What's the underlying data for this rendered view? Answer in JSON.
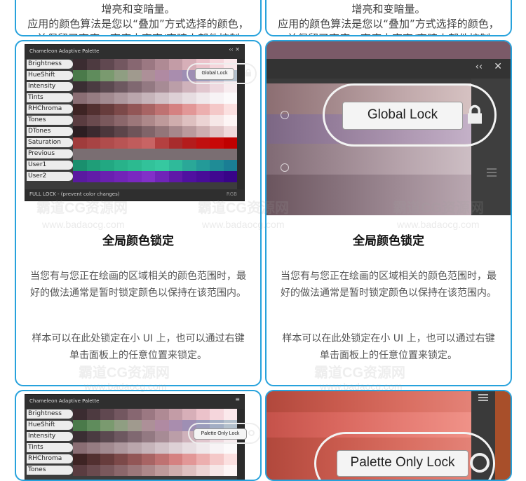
{
  "top_cards": {
    "line1": "增亮和变暗量。",
    "line2": "应用的颜色算法是您以“叠加”方式选择的颜色，",
    "line3": "并保留了亮度、亮度中变亮/变暗小部件控制"
  },
  "panel": {
    "title": "Chameleon Adaptive Palette",
    "footer": "FULL LOCK - (prevent color changes)",
    "footer_right": "RGB",
    "rows": [
      "Brightness",
      "HueShift",
      "Intensity",
      "Tints",
      "RHChroma",
      "Tones",
      "DTones",
      "Saturation",
      "Previous",
      "User1",
      "User2"
    ],
    "global_lock_label": "Global Lock",
    "palette_lock_label": "Palette Only Lock"
  },
  "cards": [
    {
      "title": "全局颜色锁定",
      "desc1": "当您有与您正在绘画的区域相关的颜色范围时，最好的做法通常是暂时锁定颜色以保持在该范围内。",
      "desc2": "样本可以在此处锁定在小 UI 上，也可以通过右键单击面板上的任意位置来锁定。"
    },
    {
      "title": "全局颜色锁定",
      "desc1": "当您有与您正在绘画的区域相关的颜色范围时，最好的做法通常是暂时锁定颜色以保持在该范围内。",
      "desc2": "样本可以在此处锁定在小 UI 上，也可以通过右键单击面板上的任意位置来锁定。"
    }
  ],
  "watermark": {
    "cn": "霸道CG资源网",
    "url": "www.badaocg.com"
  },
  "colors": {
    "accent_border": "#27a2dc"
  }
}
